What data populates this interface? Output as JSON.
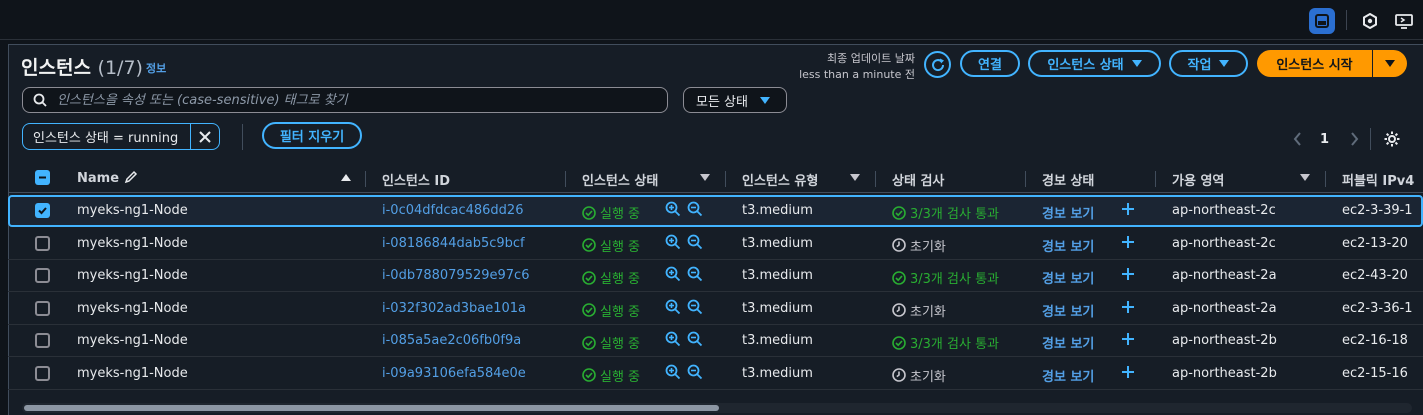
{
  "topbar": {
    "icons": [
      "panel-icon",
      "hexagon-icon",
      "monitor-icon"
    ]
  },
  "header": {
    "title": "인스턴스",
    "count": "(1/7)",
    "info_link": "정보",
    "last_updated_label": "최종 업데이트 날짜",
    "last_updated_value": "less than a minute 전"
  },
  "actions": {
    "connect": "연결",
    "instance_state": "인스턴스 상태",
    "actions": "작업",
    "launch": "인스턴스 시작"
  },
  "search": {
    "placeholder": "인스턴스을 속성 또는 (case-sensitive) 태그로 찾기",
    "value": ""
  },
  "state_filter": {
    "selected": "모든 상태"
  },
  "filter_token": {
    "text": "인스턴스 상태 = running"
  },
  "clear_filters": "필터 지우기",
  "pagination": {
    "current_page": "1"
  },
  "table": {
    "columns": [
      "Name",
      "인스턴스 ID",
      "인스턴스 상태",
      "인스턴스 유형",
      "상태 검사",
      "경보 상태",
      "가용 영역",
      "퍼블릭 IPv4"
    ],
    "rows": [
      {
        "selected": true,
        "name": "myeks-ng1-Node",
        "id": "i-0c04dfdcac486dd26",
        "state": "실행 중",
        "type": "t3.medium",
        "check": "3/3개 검사 통과",
        "check_ok": true,
        "alarm": "경보 보기",
        "az": "ap-northeast-2c",
        "ip": "ec2-3-39-1"
      },
      {
        "selected": false,
        "name": "myeks-ng1-Node",
        "id": "i-08186844dab5c9bcf",
        "state": "실행 중",
        "type": "t3.medium",
        "check": "초기화",
        "check_ok": false,
        "alarm": "경보 보기",
        "az": "ap-northeast-2c",
        "ip": "ec2-13-20"
      },
      {
        "selected": false,
        "name": "myeks-ng1-Node",
        "id": "i-0db788079529e97c6",
        "state": "실행 중",
        "type": "t3.medium",
        "check": "3/3개 검사 통과",
        "check_ok": true,
        "alarm": "경보 보기",
        "az": "ap-northeast-2a",
        "ip": "ec2-43-20"
      },
      {
        "selected": false,
        "name": "myeks-ng1-Node",
        "id": "i-032f302ad3bae101a",
        "state": "실행 중",
        "type": "t3.medium",
        "check": "초기화",
        "check_ok": false,
        "alarm": "경보 보기",
        "az": "ap-northeast-2a",
        "ip": "ec2-3-36-1"
      },
      {
        "selected": false,
        "name": "myeks-ng1-Node",
        "id": "i-085a5ae2c06fb0f9a",
        "state": "실행 중",
        "type": "t3.medium",
        "check": "3/3개 검사 통과",
        "check_ok": true,
        "alarm": "경보 보기",
        "az": "ap-northeast-2b",
        "ip": "ec2-16-18"
      },
      {
        "selected": false,
        "name": "myeks-ng1-Node",
        "id": "i-09a93106efa584e0e",
        "state": "실행 중",
        "type": "t3.medium",
        "check": "초기화",
        "check_ok": false,
        "alarm": "경보 보기",
        "az": "ap-northeast-2b",
        "ip": "ec2-15-16"
      }
    ]
  },
  "colors": {
    "accent": "#42b4ff",
    "launch": "#ff9900",
    "ok": "#29ad32",
    "link": "#539fe5"
  }
}
